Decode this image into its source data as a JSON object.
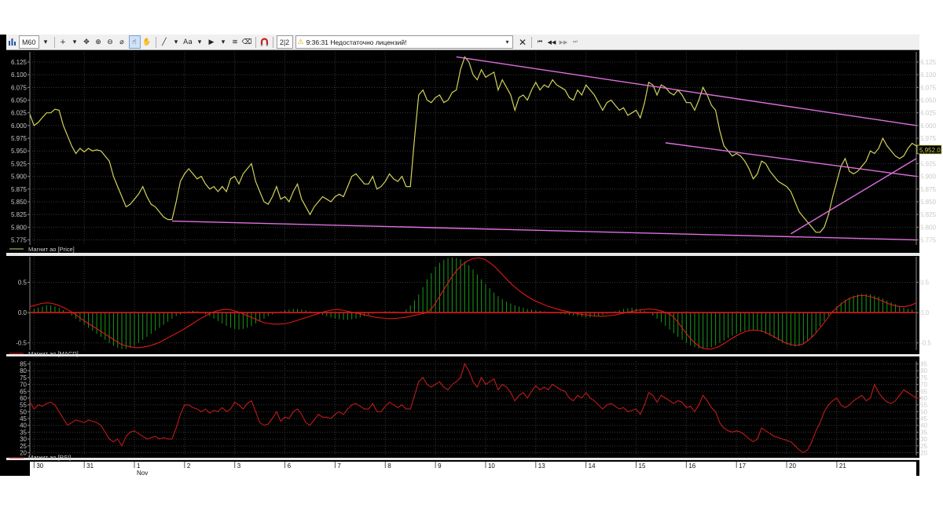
{
  "toolbar": {
    "timeframe": "M60",
    "layout_value": "2|2",
    "status_time": "9:36:31",
    "status_message": "Недостаточно лицензий!",
    "font_label": "Aa",
    "icons": [
      "chart-bars-icon",
      "crosshair-icon",
      "move-icon",
      "zoom-in-icon",
      "zoom-out-icon",
      "ruler-icon",
      "hand-pointer-icon",
      "hand-icon",
      "line-draw-icon",
      "text-icon",
      "fill-icon",
      "indicator-icon",
      "magnet-icon",
      "close-icon",
      "first-icon",
      "prev-icon",
      "next-icon",
      "last-icon"
    ]
  },
  "colors": {
    "background": "#000000",
    "grid": "#3a3a3a",
    "price_line": "#d2d25a",
    "trend_lines": "#e070e0",
    "macd_line": "#e01818",
    "macd_hist": "#1a9a1a",
    "rsi_line": "#c01a1a",
    "separator": "#e8e8e8"
  },
  "chart_data": [
    {
      "type": "line",
      "panel": "price",
      "series_label": "Магнит ао [Price]",
      "last_value_label": "5,952.0",
      "y_ticks": [
        "6.125",
        "6.100",
        "6.075",
        "6.050",
        "6.025",
        "6.000",
        "5.975",
        "5.950",
        "5.925",
        "5.900",
        "5.875",
        "5.850",
        "5.825",
        "5.800",
        "5.775"
      ],
      "ylim": [
        5.765,
        6.145
      ],
      "xlim": [
        0,
        212
      ],
      "values": [
        6.022,
        6.0,
        6.006,
        6.016,
        6.025,
        6.025,
        6.032,
        6.03,
        6.0,
        5.98,
        5.96,
        5.945,
        5.955,
        5.948,
        5.955,
        5.95,
        5.952,
        5.95,
        5.94,
        5.93,
        5.9,
        5.88,
        5.86,
        5.84,
        5.845,
        5.855,
        5.865,
        5.88,
        5.86,
        5.845,
        5.84,
        5.83,
        5.82,
        5.815,
        5.815,
        5.85,
        5.89,
        5.905,
        5.915,
        5.905,
        5.895,
        5.9,
        5.885,
        5.875,
        5.88,
        5.87,
        5.88,
        5.87,
        5.895,
        5.9,
        5.885,
        5.905,
        5.915,
        5.925,
        5.89,
        5.87,
        5.85,
        5.845,
        5.86,
        5.88,
        5.855,
        5.86,
        5.85,
        5.87,
        5.885,
        5.855,
        5.84,
        5.825,
        5.84,
        5.85,
        5.86,
        5.855,
        5.85,
        5.86,
        5.865,
        5.86,
        5.88,
        5.9,
        5.905,
        5.895,
        5.885,
        5.885,
        5.9,
        5.875,
        5.88,
        5.89,
        5.905,
        5.895,
        5.89,
        5.9,
        5.88,
        5.88,
        5.975,
        6.06,
        6.07,
        6.05,
        6.045,
        6.055,
        6.06,
        6.045,
        6.05,
        6.065,
        6.07,
        6.11,
        6.135,
        6.125,
        6.1,
        6.09,
        6.11,
        6.095,
        6.1,
        6.105,
        6.07,
        6.09,
        6.075,
        6.06,
        6.03,
        6.055,
        6.06,
        6.05,
        6.07,
        6.085,
        6.07,
        6.08,
        6.075,
        6.09,
        6.08,
        6.075,
        6.07,
        6.055,
        6.05,
        6.07,
        6.06,
        6.08,
        6.07,
        6.06,
        6.045,
        6.03,
        6.045,
        6.05,
        6.04,
        6.03,
        6.035,
        6.02,
        6.025,
        6.03,
        6.015,
        6.045,
        6.085,
        6.08,
        6.06,
        6.08,
        6.075,
        6.065,
        6.06,
        6.07,
        6.06,
        6.045,
        6.045,
        6.03,
        6.05,
        6.075,
        6.06,
        6.04,
        6.03,
        5.99,
        5.96,
        5.95,
        5.94,
        5.945,
        5.94,
        5.93,
        5.915,
        5.895,
        5.905,
        5.93,
        5.925,
        5.91,
        5.9,
        5.89,
        5.885,
        5.88,
        5.87,
        5.85,
        5.83,
        5.82,
        5.81,
        5.8,
        5.79,
        5.79,
        5.8,
        5.825,
        5.86,
        5.89,
        5.92,
        5.935,
        5.91,
        5.905,
        5.91,
        5.92,
        5.93,
        5.95,
        5.945,
        5.955,
        5.975,
        5.96,
        5.95,
        5.94,
        5.935,
        5.94,
        5.955,
        5.965,
        5.96,
        5.955,
        5.952,
        5.952
      ],
      "trend_lines": [
        {
          "x": [
            102,
            212
          ],
          "y": [
            6.135,
            6.0
          ]
        },
        {
          "x": [
            34,
            212
          ],
          "y": [
            5.812,
            5.775
          ]
        },
        {
          "x": [
            152,
            212
          ],
          "y": [
            5.966,
            5.9
          ]
        },
        {
          "x": [
            182,
            212
          ],
          "y": [
            5.787,
            5.935
          ]
        }
      ]
    },
    {
      "type": "bar",
      "panel": "macd",
      "series_label": "Магнит ао [MACD]",
      "y_ticks": [
        "0.5",
        "0.0",
        "-0.5"
      ],
      "ylim": [
        -0.62,
        0.92
      ],
      "xlim": [
        0,
        212
      ],
      "histogram": [
        0.05,
        0.06,
        0.08,
        0.1,
        0.12,
        0.12,
        0.1,
        0.08,
        0.04,
        0.0,
        -0.05,
        -0.1,
        -0.15,
        -0.2,
        -0.25,
        -0.3,
        -0.35,
        -0.4,
        -0.45,
        -0.5,
        -0.55,
        -0.58,
        -0.6,
        -0.6,
        -0.58,
        -0.55,
        -0.5,
        -0.45,
        -0.4,
        -0.35,
        -0.3,
        -0.25,
        -0.2,
        -0.15,
        -0.1,
        -0.06,
        -0.03,
        0.0,
        0.02,
        0.03,
        0.02,
        0.0,
        -0.03,
        -0.06,
        -0.1,
        -0.14,
        -0.18,
        -0.22,
        -0.25,
        -0.27,
        -0.28,
        -0.27,
        -0.25,
        -0.22,
        -0.18,
        -0.14,
        -0.1,
        -0.06,
        -0.03,
        0.0,
        0.02,
        0.04,
        0.05,
        0.06,
        0.06,
        0.05,
        0.04,
        0.02,
        0.0,
        -0.02,
        -0.04,
        -0.06,
        -0.08,
        -0.1,
        -0.11,
        -0.12,
        -0.12,
        -0.11,
        -0.1,
        -0.08,
        -0.06,
        -0.04,
        -0.02,
        0.0,
        0.01,
        0.02,
        0.02,
        0.02,
        0.01,
        0.0,
        0.05,
        0.12,
        0.2,
        0.3,
        0.42,
        0.55,
        0.65,
        0.75,
        0.82,
        0.87,
        0.9,
        0.91,
        0.9,
        0.88,
        0.84,
        0.78,
        0.71,
        0.63,
        0.55,
        0.47,
        0.4,
        0.33,
        0.27,
        0.22,
        0.18,
        0.15,
        0.12,
        0.1,
        0.08,
        0.06,
        0.05,
        0.04,
        0.03,
        0.02,
        0.01,
        0.0,
        -0.01,
        -0.02,
        -0.03,
        -0.04,
        -0.05,
        -0.06,
        -0.07,
        -0.08,
        -0.08,
        -0.07,
        -0.06,
        -0.04,
        -0.02,
        0.0,
        0.02,
        0.04,
        0.06,
        0.07,
        0.08,
        0.07,
        0.05,
        0.03,
        0.0,
        -0.05,
        -0.1,
        -0.16,
        -0.22,
        -0.28,
        -0.34,
        -0.4,
        -0.45,
        -0.5,
        -0.54,
        -0.57,
        -0.59,
        -0.6,
        -0.59,
        -0.57,
        -0.54,
        -0.5,
        -0.46,
        -0.42,
        -0.38,
        -0.35,
        -0.32,
        -0.3,
        -0.29,
        -0.29,
        -0.3,
        -0.32,
        -0.35,
        -0.38,
        -0.42,
        -0.46,
        -0.5,
        -0.53,
        -0.55,
        -0.56,
        -0.55,
        -0.52,
        -0.47,
        -0.4,
        -0.32,
        -0.23,
        -0.14,
        -0.05,
        0.03,
        0.1,
        0.16,
        0.21,
        0.25,
        0.28,
        0.3,
        0.31,
        0.31,
        0.3,
        0.28,
        0.26,
        0.23,
        0.2,
        0.17,
        0.14,
        0.11,
        0.08,
        0.06,
        0.05,
        0.04
      ],
      "signal": [
        0.1,
        0.12,
        0.15,
        0.16,
        0.15,
        0.12,
        0.08,
        0.03,
        -0.03,
        -0.1,
        -0.16,
        -0.22,
        -0.28,
        -0.34,
        -0.4,
        -0.46,
        -0.52,
        -0.55,
        -0.57,
        -0.58,
        -0.57,
        -0.55,
        -0.52,
        -0.48,
        -0.43,
        -0.38,
        -0.33,
        -0.28,
        -0.22,
        -0.16,
        -0.1,
        -0.05,
        0.0,
        0.03,
        0.05,
        0.05,
        0.03,
        0.0,
        -0.04,
        -0.08,
        -0.12,
        -0.16,
        -0.18,
        -0.19,
        -0.19,
        -0.18,
        -0.16,
        -0.13,
        -0.1,
        -0.07,
        -0.04,
        -0.01,
        0.02,
        0.04,
        0.05,
        0.04,
        0.02,
        0.0,
        -0.02,
        -0.04,
        -0.06,
        -0.08,
        -0.09,
        -0.1,
        -0.1,
        -0.09,
        -0.08,
        -0.06,
        -0.04,
        -0.02,
        0.0,
        0.1,
        0.25,
        0.4,
        0.55,
        0.68,
        0.78,
        0.85,
        0.89,
        0.9,
        0.88,
        0.82,
        0.74,
        0.64,
        0.54,
        0.45,
        0.37,
        0.3,
        0.24,
        0.19,
        0.15,
        0.11,
        0.08,
        0.05,
        0.03,
        0.01,
        -0.01,
        -0.03,
        -0.04,
        -0.05,
        -0.06,
        -0.06,
        -0.05,
        -0.04,
        -0.02,
        0.0,
        0.02,
        0.04,
        0.05,
        0.06,
        0.05,
        0.03,
        0.0,
        -0.05,
        -0.15,
        -0.28,
        -0.4,
        -0.5,
        -0.57,
        -0.6,
        -0.6,
        -0.57,
        -0.52,
        -0.46,
        -0.4,
        -0.35,
        -0.31,
        -0.29,
        -0.29,
        -0.31,
        -0.35,
        -0.4,
        -0.45,
        -0.5,
        -0.53,
        -0.54,
        -0.52,
        -0.46,
        -0.37,
        -0.26,
        -0.14,
        -0.02,
        0.08,
        0.16,
        0.22,
        0.26,
        0.28,
        0.28,
        0.26,
        0.23,
        0.19,
        0.15,
        0.12,
        0.1,
        0.1,
        0.12,
        0.16
      ]
    },
    {
      "type": "line",
      "panel": "rsi",
      "series_label": "Магнит ао [RSI]",
      "y_ticks": [
        "85",
        "80",
        "75",
        "70",
        "65",
        "60",
        "55",
        "50",
        "45",
        "40",
        "35",
        "30",
        "25",
        "20"
      ],
      "ylim": [
        18,
        87
      ],
      "xlim": [
        0,
        212
      ],
      "values": [
        57,
        52,
        55,
        54,
        56,
        57,
        55,
        50,
        45,
        40,
        42,
        44,
        43,
        42,
        44,
        43,
        42,
        40,
        35,
        30,
        28,
        30,
        25,
        32,
        35,
        36,
        34,
        32,
        30,
        31,
        32,
        30,
        31,
        30,
        30,
        38,
        48,
        55,
        55,
        53,
        52,
        50,
        52,
        49,
        51,
        50,
        53,
        50,
        52,
        57,
        55,
        52,
        56,
        58,
        50,
        42,
        40,
        41,
        45,
        50,
        43,
        46,
        45,
        50,
        52,
        48,
        42,
        40,
        44,
        48,
        46,
        46,
        45,
        48,
        50,
        48,
        52,
        55,
        56,
        54,
        52,
        52,
        56,
        50,
        50,
        54,
        57,
        55,
        53,
        55,
        52,
        52,
        62,
        72,
        75,
        70,
        68,
        70,
        72,
        68,
        66,
        70,
        72,
        75,
        85,
        80,
        72,
        68,
        75,
        70,
        72,
        74,
        66,
        70,
        68,
        64,
        58,
        62,
        64,
        60,
        65,
        69,
        66,
        68,
        66,
        70,
        68,
        66,
        65,
        60,
        58,
        62,
        60,
        64,
        60,
        58,
        55,
        52,
        55,
        56,
        54,
        52,
        53,
        50,
        51,
        52,
        48,
        55,
        64,
        62,
        57,
        62,
        60,
        58,
        56,
        58,
        57,
        53,
        54,
        50,
        55,
        62,
        58,
        53,
        50,
        42,
        38,
        36,
        35,
        36,
        35,
        33,
        30,
        28,
        30,
        38,
        36,
        34,
        32,
        31,
        30,
        29,
        28,
        25,
        22,
        20,
        22,
        28,
        36,
        42,
        50,
        55,
        58,
        60,
        55,
        53,
        55,
        58,
        60,
        62,
        58,
        60,
        70,
        64,
        60,
        57,
        56,
        58,
        62,
        66,
        64,
        62,
        60,
        60
      ],
      "x_labels": [
        "30",
        "31",
        "1",
        "2",
        "3",
        "6",
        "7",
        "8",
        "9",
        "10",
        "13",
        "14",
        "15",
        "16",
        "17",
        "20",
        "21"
      ],
      "x_label_positions": [
        1,
        13,
        25,
        37,
        49,
        61,
        73,
        85,
        97,
        109,
        121,
        133,
        145,
        157,
        169,
        181,
        193
      ],
      "month_label": "Nov"
    }
  ]
}
